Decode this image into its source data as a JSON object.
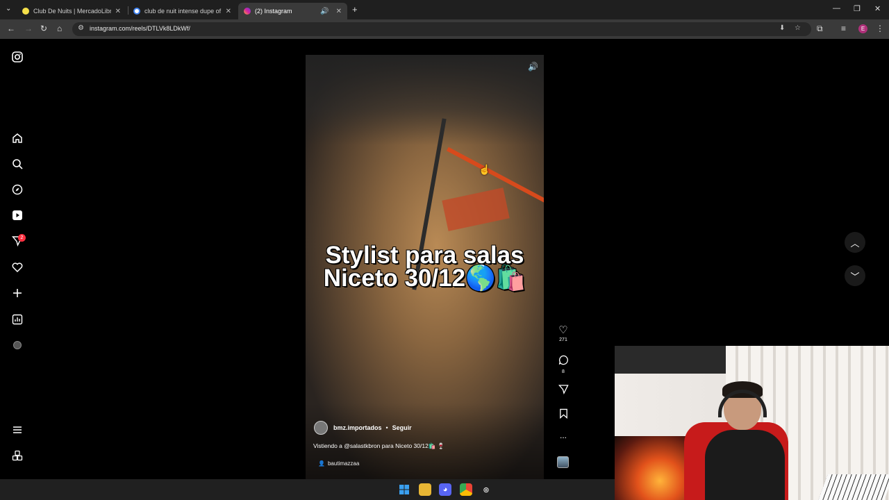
{
  "browser": {
    "tabs": [
      {
        "title": "Club De Nuits | MercadoLibre 🔇",
        "active": false
      },
      {
        "title": "club de nuit intense dupe of - E",
        "active": false
      },
      {
        "title": "(2) Instagram",
        "active": true
      }
    ],
    "new_tab": "+",
    "url": "instagram.com/reels/DTLVk8LDkWf/",
    "profile_initial": "E"
  },
  "sidebar": {
    "notification_count": "2",
    "items": [
      "instagram-logo",
      "home",
      "search",
      "explore",
      "reels",
      "messages",
      "notifications",
      "create",
      "dashboard",
      "profile",
      "more",
      "also-from-meta"
    ]
  },
  "reel": {
    "overlay_text_line1": "Stylist para salas",
    "overlay_text_line2": "Niceto 30/12🌎🛍️",
    "author": "bmz.importados",
    "separator": "•",
    "follow_label": "Seguir",
    "description": "Vistiendo a @salastkbron para Niceto 30/12🛍️ 🍷",
    "tagged_user": "bautimazzaa"
  },
  "actions": {
    "likes": "271",
    "comments": "8",
    "more_label": "..."
  },
  "colors": {
    "notification_badge": "#ff3040",
    "tab_active": "#3a3a3a",
    "browser_bg": "#1f1f1f"
  }
}
